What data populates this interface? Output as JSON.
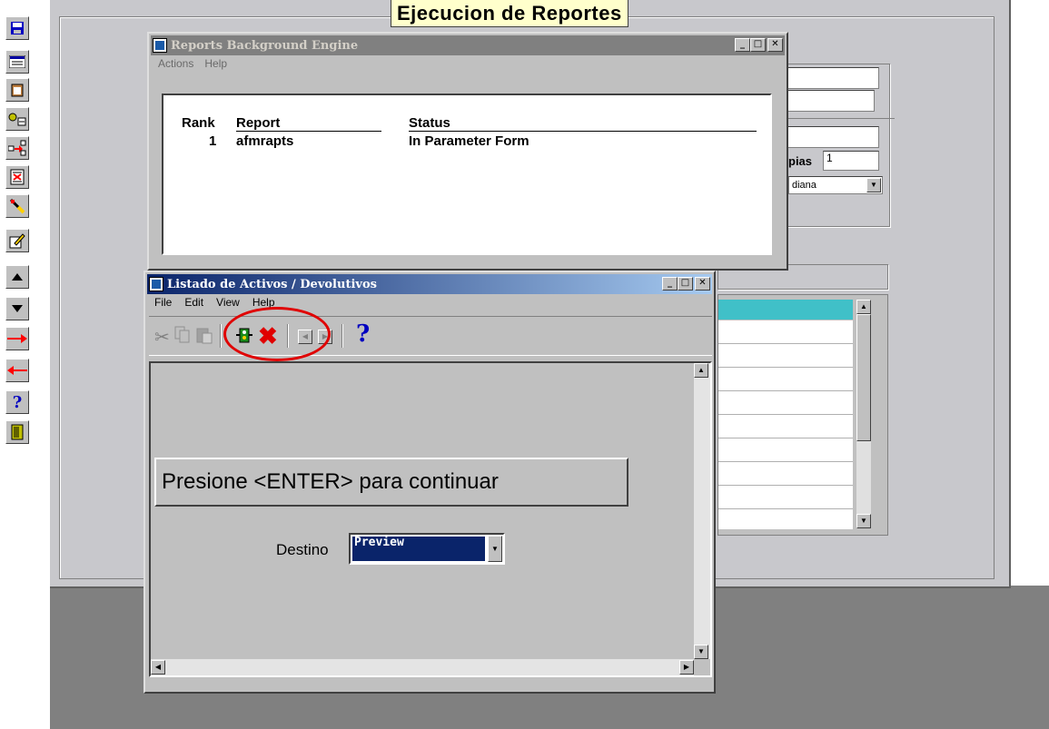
{
  "form": {
    "title": "Ejecucion de Reportes",
    "copies_label": "pias",
    "copies_value": "1",
    "select_value": "diana"
  },
  "background_engine": {
    "title": "Reports Background Engine",
    "menu": [
      "Actions",
      "Help"
    ],
    "columns": {
      "rank": "Rank",
      "report": "Report",
      "status": "Status"
    },
    "rows": [
      {
        "rank": "1",
        "report": "afmrapts",
        "status": "In Parameter Form"
      }
    ]
  },
  "parameter_form": {
    "title": "Listado de Activos / Devolutivos",
    "menu": [
      "File",
      "Edit",
      "View",
      "Help"
    ],
    "prompt": "Presione <ENTER> para continuar",
    "destino_label": "Destino",
    "destino_value": "Preview",
    "help_glyph": "?"
  },
  "left_toolbar": {
    "icons": [
      "save-icon",
      "list-icon",
      "clipboard-icon",
      "query-icon",
      "insert-record-icon",
      "delete-record-icon",
      "clear-icon",
      "edit-icon",
      "up-arrow-icon",
      "down-arrow-icon",
      "next-icon",
      "previous-icon",
      "help-icon",
      "exit-icon"
    ],
    "help_glyph": "?"
  },
  "colors": {
    "accent_teal": "#40c0c8",
    "titlebar_active": "#0a246a",
    "highlight": "#ff0000",
    "select_bg": "#0a246a"
  }
}
